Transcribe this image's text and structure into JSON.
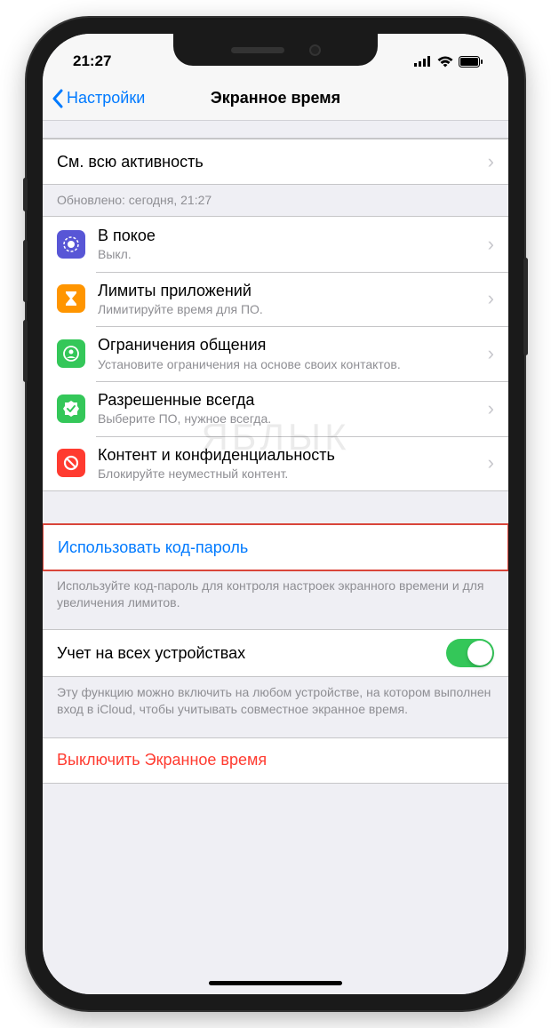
{
  "status": {
    "time": "21:27"
  },
  "nav": {
    "back": "Настройки",
    "title": "Экранное время"
  },
  "activity": {
    "see_all": "См. всю активность",
    "updated": "Обновлено: сегодня, 21:27"
  },
  "features": [
    {
      "icon": "moon",
      "color": "#5856d6",
      "title": "В покое",
      "sub": "Выкл."
    },
    {
      "icon": "hourglass",
      "color": "#ff9500",
      "title": "Лимиты приложений",
      "sub": "Лимитируйте время для ПО."
    },
    {
      "icon": "contact",
      "color": "#34c759",
      "title": "Ограничения общения",
      "sub": "Установите ограничения на основе своих контактов."
    },
    {
      "icon": "check",
      "color": "#34c759",
      "title": "Разрешенные всегда",
      "sub": "Выберите ПО, нужное всегда."
    },
    {
      "icon": "nosign",
      "color": "#ff3b30",
      "title": "Контент и конфиденциальность",
      "sub": "Блокируйте неуместный контент."
    }
  ],
  "passcode": {
    "label": "Использовать код-пароль",
    "footer": "Используйте код-пароль для контроля настроек экранного времени и для увеличения лимитов."
  },
  "share": {
    "label": "Учет на всех устройствах",
    "on": true,
    "footer": "Эту функцию можно включить на любом устройстве, на котором выполнен вход в iCloud, чтобы учитывать совместное экранное время."
  },
  "turn_off": "Выключить Экранное время",
  "watermark": "ЯБЛЫК"
}
